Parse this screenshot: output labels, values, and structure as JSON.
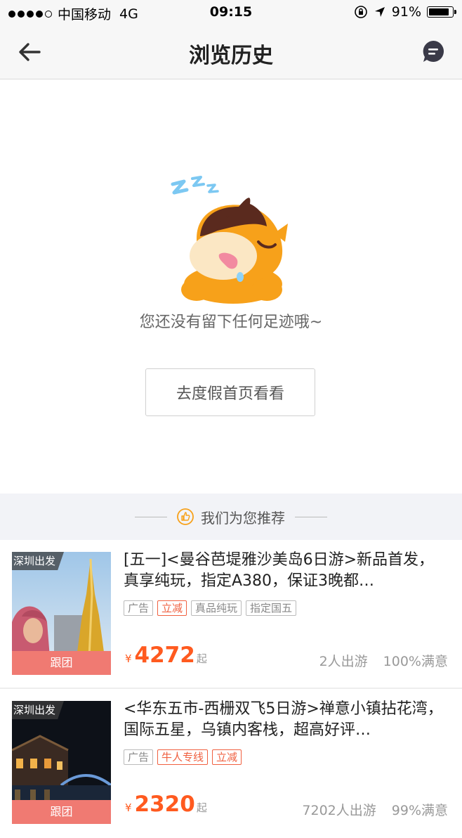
{
  "status_bar": {
    "carrier": "中国移动",
    "network": "4G",
    "time": "09:15",
    "battery": "91%",
    "battery_level": 0.91
  },
  "nav": {
    "title": "浏览历史",
    "back_icon": "arrow-left-icon",
    "message_icon": "chat-bubble-icon"
  },
  "empty_state": {
    "message": "您还没有留下任何足迹哦~",
    "button": "去度假首页看看",
    "illustration": "sleeping-cow-mascot"
  },
  "recommend": {
    "label": "我们为您推荐",
    "icon": "thumbs-up-icon"
  },
  "products": [
    {
      "origin": "深圳出发",
      "type": "跟团",
      "title": "[五一]<曼谷芭堤雅沙美岛6日游>新品首发，真享纯玩，指定A380，保证3晚都…",
      "tags": [
        {
          "text": "广告",
          "style": "gray"
        },
        {
          "text": "立减",
          "style": "red"
        },
        {
          "text": "真品纯玩",
          "style": "gray"
        },
        {
          "text": "指定国五",
          "style": "gray"
        }
      ],
      "currency": "¥",
      "price": "4272",
      "price_suffix": "起",
      "travelers": "2人出游",
      "satisfaction": "100%满意"
    },
    {
      "origin": "深圳出发",
      "type": "跟团",
      "title": "<华东五市-西栅双飞5日游>禅意小镇拈花湾，国际五星，乌镇内客栈，超高好评…",
      "tags": [
        {
          "text": "广告",
          "style": "gray"
        },
        {
          "text": "牛人专线",
          "style": "red"
        },
        {
          "text": "立减",
          "style": "red"
        }
      ],
      "currency": "¥",
      "price": "2320",
      "price_suffix": "起",
      "travelers": "7202人出游",
      "satisfaction": "99%满意"
    }
  ],
  "colors": {
    "price": "#ff5a1f",
    "accent_orange": "#f7a11a",
    "tag_red": "#f06040",
    "type_badge": "#f07a72"
  }
}
